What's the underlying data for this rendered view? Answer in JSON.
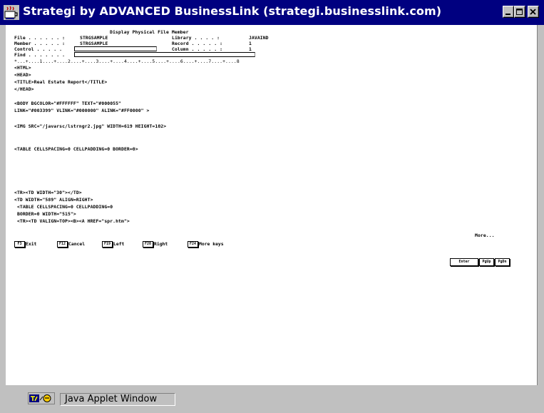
{
  "window": {
    "title": "Strategi by ADVANCED BusinessLink  (strategi.businesslink.com)",
    "icon": "java-cup-icon",
    "controls": [
      "minimize",
      "maximize",
      "close"
    ]
  },
  "screen": {
    "heading": "Display Physical File Member",
    "info": [
      {
        "label": "File . . . . . . :",
        "value": "STRGSAMPLE"
      },
      {
        "label": "Member . . . . . :",
        "value": "STRGSAMPLE"
      },
      {
        "label": "Library . . . . :",
        "value": "JAVAIND"
      },
      {
        "label": "Record . . . . . :",
        "value": "1"
      },
      {
        "label": "Control . . . . .",
        "value": ""
      },
      {
        "label": "Column . . . . . :",
        "value": "1"
      },
      {
        "label": "Find . . . . . . .",
        "value": ""
      }
    ],
    "ruler": "*...+....1....+....2....+....3....+....4....+....5....+....6....+....7....+....8",
    "lines": [
      "<HTML>",
      "<HEAD>",
      "<TITLE>Real Estate Report</TITLE>",
      "</HEAD>",
      "",
      "<BODY BGCOLOR=\"#FFFFFF\" TEXT=\"#000055\"",
      "LINK=\"#003399\" VLINK=\"#000000\" ALINK=\"#FF0000\" >",
      "",
      "<IMG SRC=\"/javarsc/lstrngr2.jpg\" WIDTH=619 HEIGHT=102>",
      "",
      "",
      "<TABLE CELLSPACING=0 CELLPADDING=0 BORDER=0>",
      "",
      "<TR><TD WIDTH=\"30\"></TD>",
      "<TD WIDTH=\"589\" ALIGN=RIGHT>",
      " <TABLE CELLSPACING=0 CELLPADDING=0",
      " BORDER=0 WIDTH=\"515\">",
      " <TR><TD VALIGN=TOP><B><A HREF=\"spr.htm\">"
    ],
    "more": "More...",
    "function_keys": [
      {
        "key": "F3",
        "label": "Exit"
      },
      {
        "key": "F12",
        "label": "Cancel"
      },
      {
        "key": "F19",
        "label": "Left"
      },
      {
        "key": "F20",
        "label": "Right"
      },
      {
        "key": "F24",
        "label": "More keys"
      }
    ],
    "page_buttons": [
      "Enter",
      "PgUp",
      "PgDn"
    ]
  },
  "statusbar": {
    "icon": "java-applet-icon",
    "label": "Java Applet Window"
  }
}
